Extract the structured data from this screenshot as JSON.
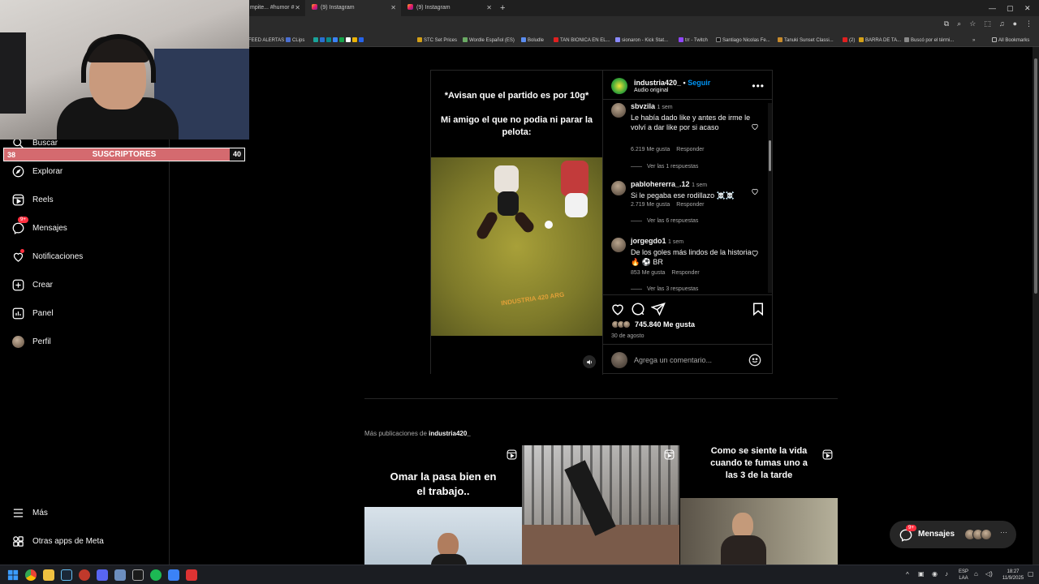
{
  "browser": {
    "tabs": [
      {
        "label": "mpite... #humor #",
        "active": false
      },
      {
        "label": "(9) Instagram",
        "active": true
      },
      {
        "label": "(9) Instagram",
        "active": false
      }
    ],
    "new_tab": "+",
    "window_controls": {
      "minimize": "—",
      "restore": "▢",
      "close": "✕"
    },
    "bookmarks": [
      {
        "label": "FEED ALERTAS",
        "color": "#555555"
      },
      {
        "label": "CLips",
        "color": "#4a6fd1"
      },
      {
        "label": "STC Set Prices",
        "color": "#d4a017"
      },
      {
        "label": "Wordle Español (ES)",
        "color": "#6aaa64"
      },
      {
        "label": "Boludle",
        "color": "#5b8def"
      },
      {
        "label": "TAN BIONICA EN EL...",
        "color": "#e02020"
      },
      {
        "label": "sionaron - Kick Stat...",
        "color": "#8a8aff"
      },
      {
        "label": "trr - Twitch",
        "color": "#9146ff"
      },
      {
        "label": "Santiago Nicolas Fe...",
        "color": "#111111"
      },
      {
        "label": "Tanuki Sunset Classi...",
        "color": "#c98b2b"
      },
      {
        "label": "(2)",
        "color": "#e02020"
      },
      {
        "label": "BARRA DE TA...",
        "color": "#d4a017"
      },
      {
        "label": "Buscó por el térmi...",
        "color": "#888888"
      }
    ],
    "all_bookmarks": "All Bookmarks"
  },
  "overlay": {
    "sub_left": "38",
    "sub_label": "SUSCRIPTORES",
    "sub_right": "40"
  },
  "sidebar": {
    "items": [
      {
        "label": "Buscar",
        "icon": "search-icon"
      },
      {
        "label": "Explorar",
        "icon": "compass-icon"
      },
      {
        "label": "Reels",
        "icon": "reels-icon"
      },
      {
        "label": "Mensajes",
        "icon": "messenger-icon",
        "badge": "9+"
      },
      {
        "label": "Notificaciones",
        "icon": "heart-icon"
      },
      {
        "label": "Crear",
        "icon": "plus-square-icon"
      },
      {
        "label": "Panel",
        "icon": "chart-icon"
      },
      {
        "label": "Perfil",
        "icon": "avatar"
      }
    ],
    "bottom": [
      {
        "label": "Más",
        "icon": "menu-icon"
      },
      {
        "label": "Otras apps de Meta",
        "icon": "meta-apps-icon"
      }
    ]
  },
  "post": {
    "media_text": "*Avisan que el partido es por 10g*\n\nMi amigo el que no podia ni parar la pelota:",
    "watermark": "INDUSTRIA 420 ARG",
    "account": "industria420_",
    "separator": " • ",
    "follow": "Seguir",
    "audio": "Audio original",
    "comments": [
      {
        "user": "sbvzila",
        "time": "1 sem",
        "text": "Le había dado like y antes de irme le volví a dar like por si acaso",
        "likes": "6.219 Me gusta",
        "reply": "Responder",
        "replies": "Ver las 1 respuestas"
      },
      {
        "user": "pablohererra_.12",
        "time": "1 sem",
        "text": "Si le pegaba ese rodillazo ☠️☠️",
        "likes": "2.719 Me gusta",
        "reply": "Responder",
        "replies": "Ver las 6 respuestas"
      },
      {
        "user": "jorgegdo1",
        "time": "1 sem",
        "text": "De los goles más lindos de la historia 🔥 ⚽ BR",
        "likes": "853 Me gusta",
        "reply": "Responder",
        "replies": "Ver las 3 respuestas"
      }
    ],
    "likes": "745.840 Me gusta",
    "date": "30 de agosto",
    "comment_placeholder": "Agrega un comentario..."
  },
  "more": {
    "prefix": "Más publicaciones de ",
    "account": "industria420_",
    "items": [
      {
        "caption": "Omar la pasa bien en el trabajo.."
      },
      {
        "caption": ""
      },
      {
        "caption": "Como se siente la vida cuando te fumas uno a las 3 de la tarde"
      }
    ]
  },
  "messages_pill": {
    "label": "Mensajes",
    "badge": "9+"
  },
  "taskbar": {
    "lang_top": "ESP",
    "lang_bottom": "LAA",
    "time": "18:27",
    "date": "11/9/2025"
  },
  "colors": {
    "accent": "#0095f6",
    "badge": "#ff3040",
    "sub_bar": "#d46a6f"
  }
}
